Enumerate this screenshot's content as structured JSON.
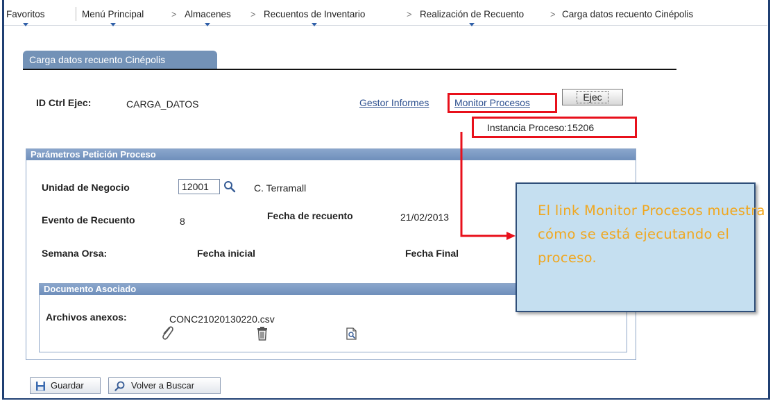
{
  "breadcrumb": {
    "items": [
      "Favoritos",
      "Menú Principal",
      "Almacenes",
      "Recuentos de Inventario",
      "Realización de Recuento",
      "Carga datos recuento Cinépolis"
    ],
    "separator": ">"
  },
  "tab": {
    "label": "Carga datos recuento Cinépolis"
  },
  "header": {
    "run_ctrl_label": "ID Ctrl Ejec:",
    "run_ctrl_value": "CARGA_DATOS",
    "report_manager_link": "Gestor Informes",
    "process_monitor_link": "Monitor Procesos",
    "run_button": "Ejec",
    "process_instance": "Instancia Proceso:15206"
  },
  "params": {
    "title": "Parámetros Petición Proceso",
    "business_unit_label": "Unidad de Negocio",
    "business_unit_value": "12001",
    "business_unit_desc": "C. Terramall",
    "count_event_label": "Evento de Recuento",
    "count_event_value": "8",
    "count_date_label": "Fecha de recuento",
    "count_date_value": "21/02/2013",
    "week_label": "Semana Orsa:",
    "start_date_label": "Fecha inicial",
    "end_date_label": "Fecha Final"
  },
  "attachments": {
    "title": "Documento Asociado",
    "label": "Archivos anexos:",
    "file_name": "CONC21020130220.csv",
    "icons": [
      "paperclip-icon",
      "trash-icon",
      "view-document-icon"
    ]
  },
  "footer": {
    "save_button": "Guardar",
    "return_search_button": "Volver a Buscar"
  },
  "callout": {
    "text": "El link Monitor Procesos muestra cómo se está ejecutando el proceso."
  },
  "colors": {
    "highlight": "#e8101b",
    "callout_bg": "#c5dff0",
    "callout_text": "#f0a71f",
    "group_header": "#7392b7",
    "frame": "#1f3f72"
  }
}
